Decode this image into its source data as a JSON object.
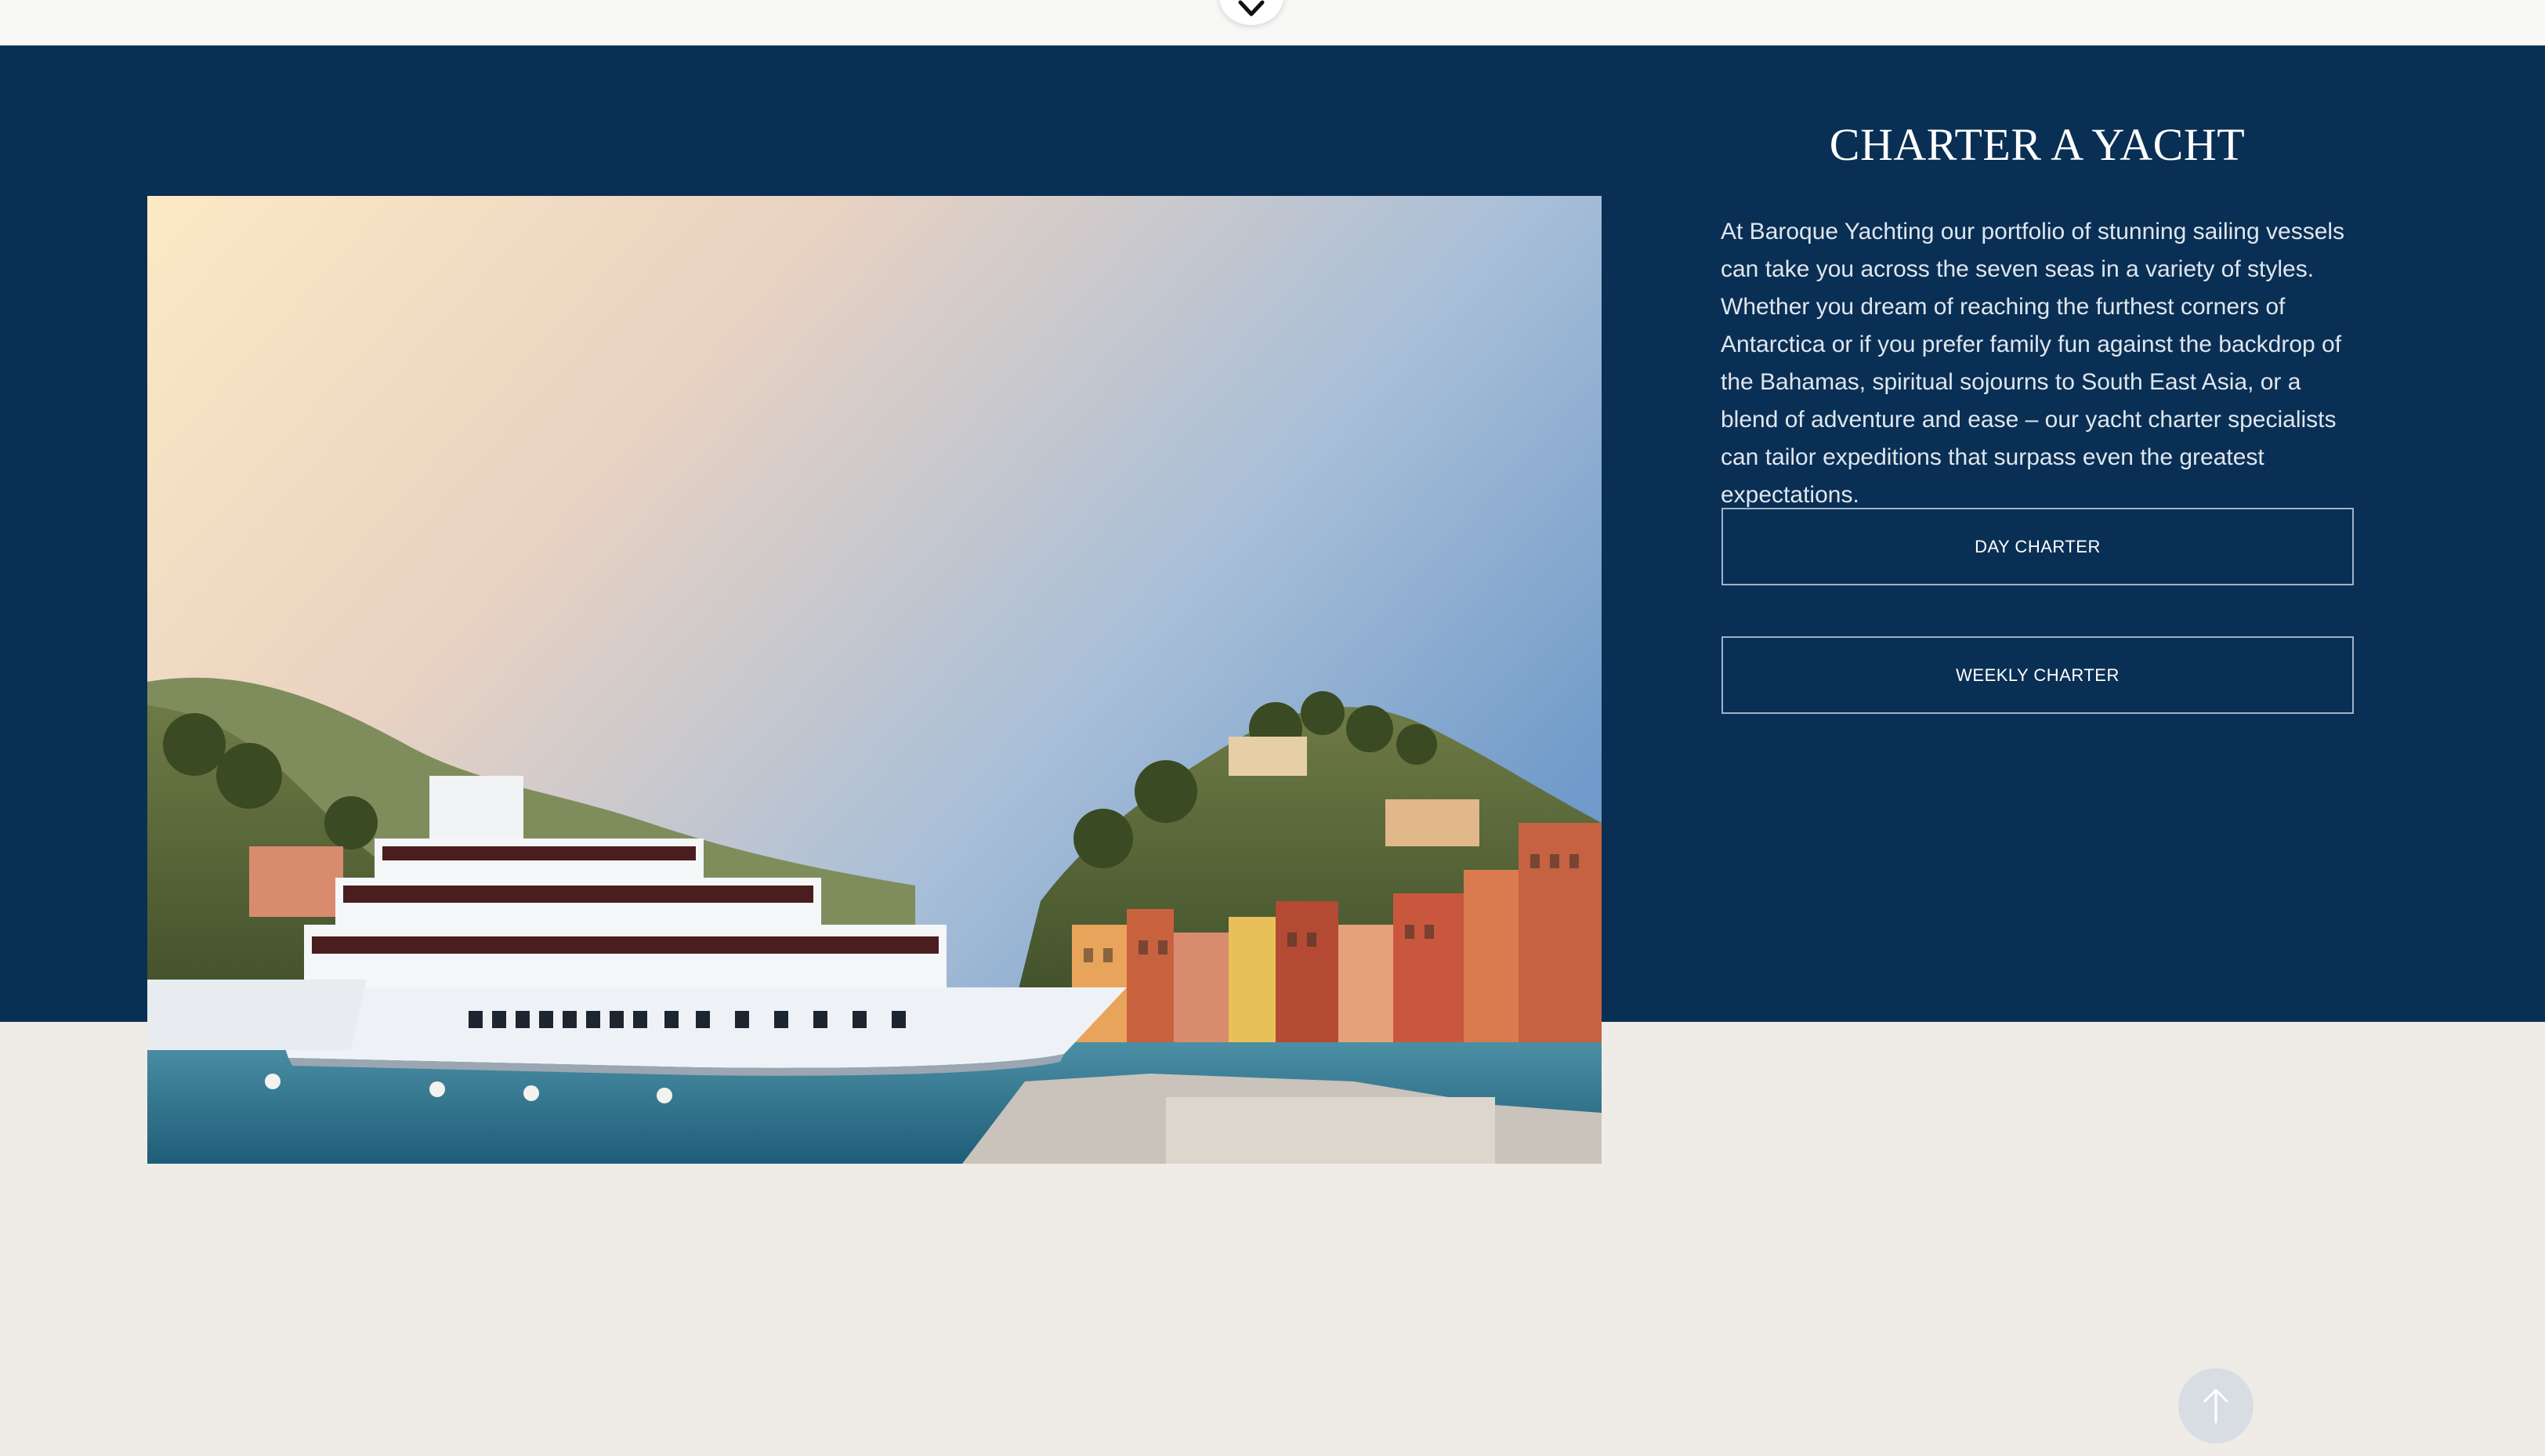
{
  "section": {
    "title": "CHARTER A YACHT",
    "description": "At Baroque Yachting our portfolio of stunning sailing vessels can take you across the seven seas in a variety of styles. Whether you dream of reaching the furthest corners of Antarctica or if you prefer family fun against the backdrop of the Bahamas, spiritual sojourns to South East Asia, or a blend of adventure and ease – our yacht charter specialists can tailor expeditions that surpass even the greatest expectations."
  },
  "buttons": {
    "day_charter": "DAY CHARTER",
    "weekly_charter": "WEEKLY CHARTER"
  },
  "icons": {
    "scroll_down": "chevron-down-icon",
    "back_to_top": "arrow-up-icon"
  },
  "colors": {
    "navy": "#0a2f54",
    "cream": "#efebe6",
    "top_strip": "#f8f8f7"
  }
}
